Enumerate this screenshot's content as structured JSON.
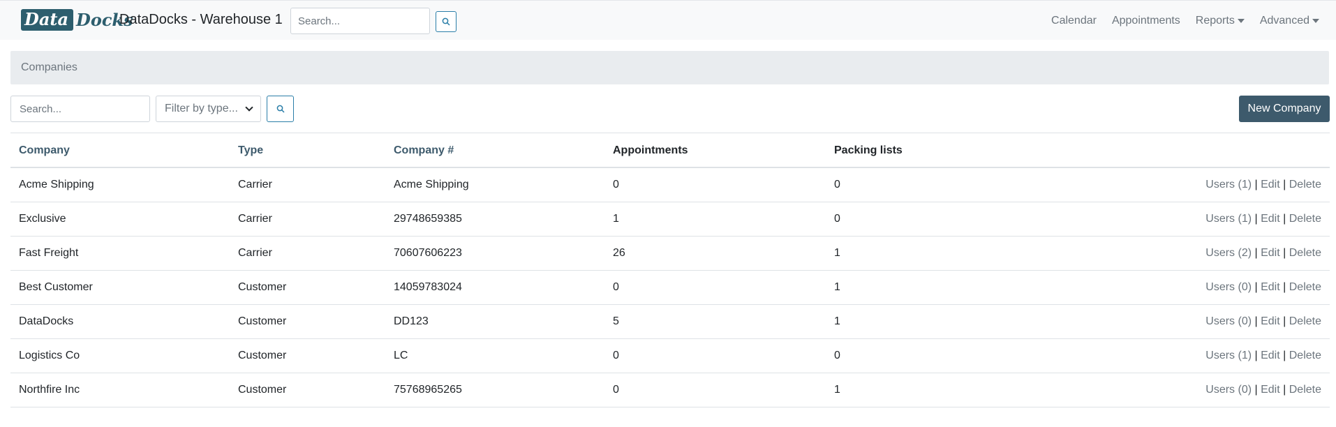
{
  "brand": {
    "logo_part1": "Data",
    "logo_part2": "Docks",
    "title": "DataDocks - Warehouse 1"
  },
  "nav": {
    "search_placeholder": "Search...",
    "links": [
      {
        "label": "Calendar",
        "dropdown": false
      },
      {
        "label": "Appointments",
        "dropdown": false
      },
      {
        "label": "Reports",
        "dropdown": true
      },
      {
        "label": "Advanced",
        "dropdown": true
      }
    ]
  },
  "breadcrumb": {
    "current": "Companies"
  },
  "filters": {
    "search_placeholder": "Search...",
    "type_filter_value": "Filter by type..."
  },
  "new_button_label": "New Company",
  "table": {
    "columns": [
      "Company",
      "Type",
      "Company #",
      "Appointments",
      "Packing lists"
    ],
    "action_labels": {
      "edit": "Edit",
      "delete": "Delete",
      "separator": "|"
    },
    "rows": [
      {
        "company": "Acme Shipping",
        "type": "Carrier",
        "number": "Acme Shipping",
        "appointments": "0",
        "packing_lists": "0",
        "users_label": "Users (1)"
      },
      {
        "company": "Exclusive",
        "type": "Carrier",
        "number": "29748659385",
        "appointments": "1",
        "packing_lists": "0",
        "users_label": "Users (1)"
      },
      {
        "company": "Fast Freight",
        "type": "Carrier",
        "number": "70607606223",
        "appointments": "26",
        "packing_lists": "1",
        "users_label": "Users (2)"
      },
      {
        "company": "Best Customer",
        "type": "Customer",
        "number": "14059783024",
        "appointments": "0",
        "packing_lists": "1",
        "users_label": "Users (0)"
      },
      {
        "company": "DataDocks",
        "type": "Customer",
        "number": "DD123",
        "appointments": "5",
        "packing_lists": "1",
        "users_label": "Users (0)"
      },
      {
        "company": "Logistics Co",
        "type": "Customer",
        "number": "LC",
        "appointments": "0",
        "packing_lists": "0",
        "users_label": "Users (1)"
      },
      {
        "company": "Northfire Inc",
        "type": "Customer",
        "number": "75768965265",
        "appointments": "0",
        "packing_lists": "1",
        "users_label": "Users (0)"
      }
    ]
  },
  "colors": {
    "brand": "#2d5e6e",
    "primary_button": "#3d5a6c",
    "link": "#3d5a6c",
    "muted": "#6c757d",
    "outline": "#2a7ea8"
  }
}
